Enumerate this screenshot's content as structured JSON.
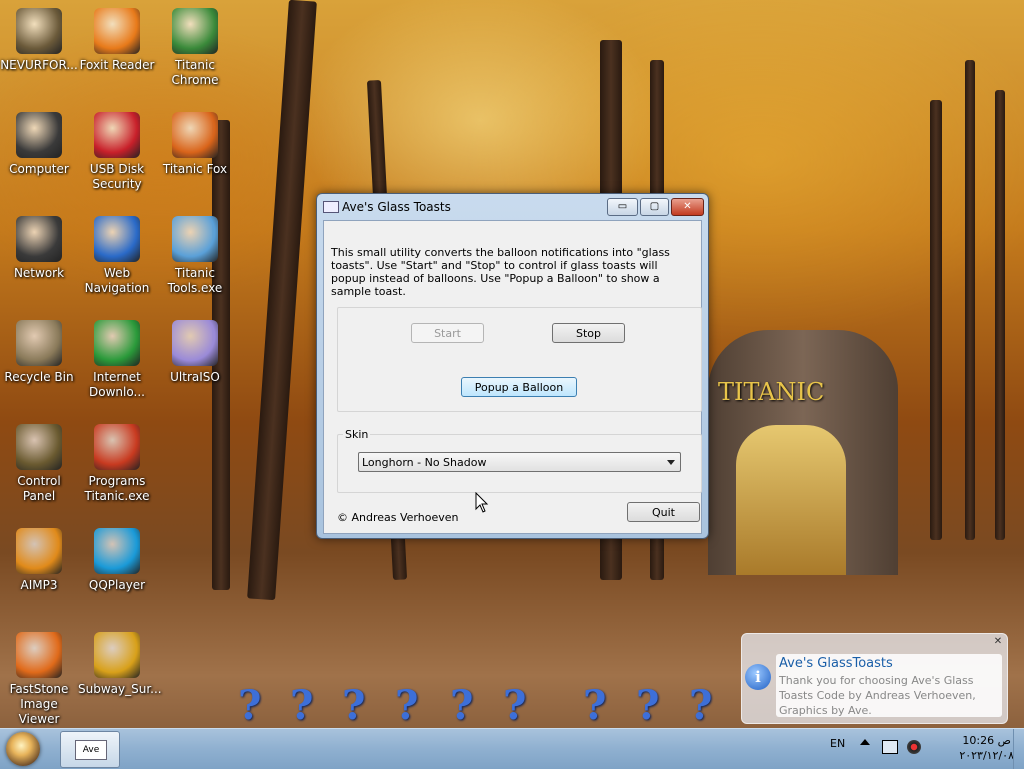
{
  "desktop": {
    "icons": [
      {
        "label": "NEVURFOR...",
        "icon": "folder-user-icon",
        "color": "#6b5a3a"
      },
      {
        "label": "Foxit Reader",
        "icon": "pdf-icon",
        "color": "#e87a1a"
      },
      {
        "label": "Titanic Chrome",
        "icon": "chrome-icon",
        "color": "#3a8a3a"
      },
      {
        "label": "Computer",
        "icon": "computer-icon",
        "color": "#3a3a3a"
      },
      {
        "label": "USB Disk Security",
        "icon": "shield-icon",
        "color": "#c8202a"
      },
      {
        "label": "Titanic Fox",
        "icon": "firefox-icon",
        "color": "#d9641a"
      },
      {
        "label": "Network",
        "icon": "network-icon",
        "color": "#3a3a3a"
      },
      {
        "label": "Web Navigation",
        "icon": "globe-icon",
        "color": "#2a6ac8"
      },
      {
        "label": "Titanic Tools.exe",
        "icon": "tools-icon",
        "color": "#5aa0d8"
      },
      {
        "label": "Recycle Bin",
        "icon": "recycle-bin-icon",
        "color": "#8a7a5a"
      },
      {
        "label": "Internet Downlo...",
        "icon": "download-icon",
        "color": "#2a9a3a"
      },
      {
        "label": "UltraISO",
        "icon": "disc-icon",
        "color": "#9a8ad8"
      },
      {
        "label": "Control Panel",
        "icon": "control-panel-icon",
        "color": "#6a5a30"
      },
      {
        "label": "Programs Titanic.exe",
        "icon": "programs-icon",
        "color": "#c83a20"
      },
      {
        "label": "AIMP3",
        "icon": "aimp-icon",
        "color": "#e08a1a"
      },
      {
        "label": "QQPlayer",
        "icon": "qqplayer-icon",
        "color": "#1a9ad8"
      },
      {
        "label": "FastStone Image Viewer",
        "icon": "eye-icon",
        "color": "#e06a1a"
      },
      {
        "label": "Subway_Sur...",
        "icon": "game-icon",
        "color": "#d8a01a"
      }
    ],
    "wallpaper_sign": "TITANIC",
    "dock_glyph": "?"
  },
  "window": {
    "title": "Ave's Glass Toasts",
    "description": "This small utility converts the balloon notifications into \"glass toasts\". Use \"Start\" and \"Stop\" to control if glass toasts will popup instead of balloons. Use \"Popup a Balloon\" to show a sample toast.",
    "start_label": "Start",
    "stop_label": "Stop",
    "popup_label": "Popup a Balloon",
    "skin_label": "Skin",
    "skin_value": "Longhorn - No Shadow",
    "copyright": "© Andreas Verhoeven",
    "quit_label": "Quit",
    "minimize_glyph": "▭",
    "maximize_glyph": "▢",
    "close_glyph": "✕"
  },
  "toast": {
    "title": "Ave's GlassToasts",
    "body": "Thank you for choosing Ave's Glass Toasts Code by Andreas Verhoeven, Graphics by Ave.",
    "close_glyph": "✕",
    "info_glyph": "i"
  },
  "taskbar": {
    "task_label": "Ave",
    "language": "EN",
    "time": "10:26 ص",
    "date": "٢٠٢٣/١٢/٠٨"
  }
}
